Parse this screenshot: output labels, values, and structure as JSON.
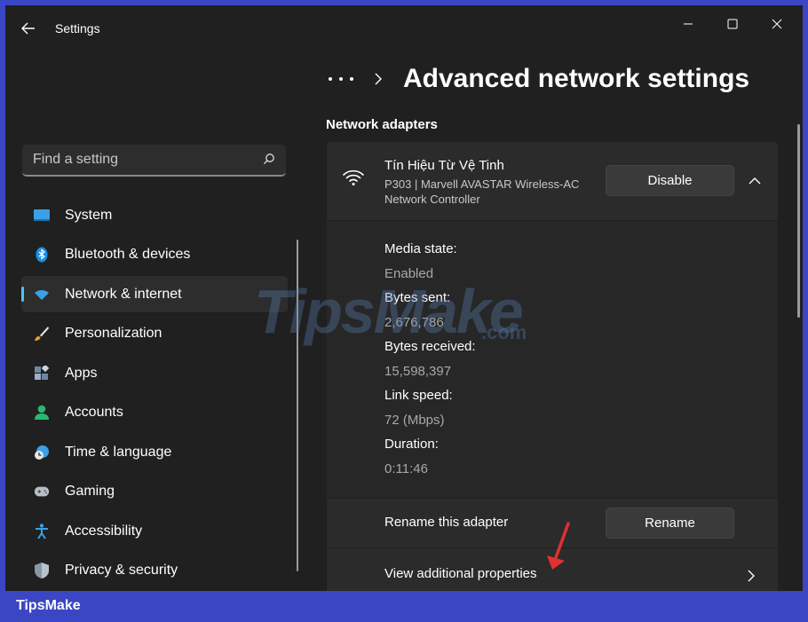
{
  "app": {
    "title": "Settings"
  },
  "sidebar": {
    "search": {
      "placeholder": "Find a setting"
    },
    "items": [
      {
        "label": "System",
        "icon": "system-icon"
      },
      {
        "label": "Bluetooth & devices",
        "icon": "bluetooth-icon"
      },
      {
        "label": "Network & internet",
        "icon": "wifi-icon",
        "active": true
      },
      {
        "label": "Personalization",
        "icon": "brush-icon"
      },
      {
        "label": "Apps",
        "icon": "apps-icon"
      },
      {
        "label": "Accounts",
        "icon": "person-icon"
      },
      {
        "label": "Time & language",
        "icon": "clock-globe-icon"
      },
      {
        "label": "Gaming",
        "icon": "gamepad-icon"
      },
      {
        "label": "Accessibility",
        "icon": "accessibility-icon"
      },
      {
        "label": "Privacy & security",
        "icon": "shield-icon"
      }
    ]
  },
  "main": {
    "breadcrumb": {
      "title": "Advanced network settings"
    },
    "section_title": "Network adapters",
    "adapter": {
      "name": "Tín Hiệu Từ Vệ Tinh",
      "description": "P303 | Marvell AVASTAR Wireless-AC Network Controller",
      "disable_label": "Disable"
    },
    "details": [
      {
        "label": "Media state:",
        "value": "Enabled"
      },
      {
        "label": "Bytes sent:",
        "value": "2,676,786"
      },
      {
        "label": "Bytes received:",
        "value": "15,598,397"
      },
      {
        "label": "Link speed:",
        "value": "72 (Mbps)"
      },
      {
        "label": "Duration:",
        "value": "0:11:46"
      }
    ],
    "rename": {
      "label": "Rename this adapter",
      "button": "Rename"
    },
    "properties": {
      "label": "View additional properties"
    }
  },
  "watermark": {
    "text": "TipsMake",
    "suffix": ".com"
  },
  "brand": {
    "text": "TipsMake"
  },
  "colors": {
    "accent": "#4cc2ff",
    "background": "#202020",
    "frame": "#3a46c4",
    "annotation": "#e03030"
  }
}
